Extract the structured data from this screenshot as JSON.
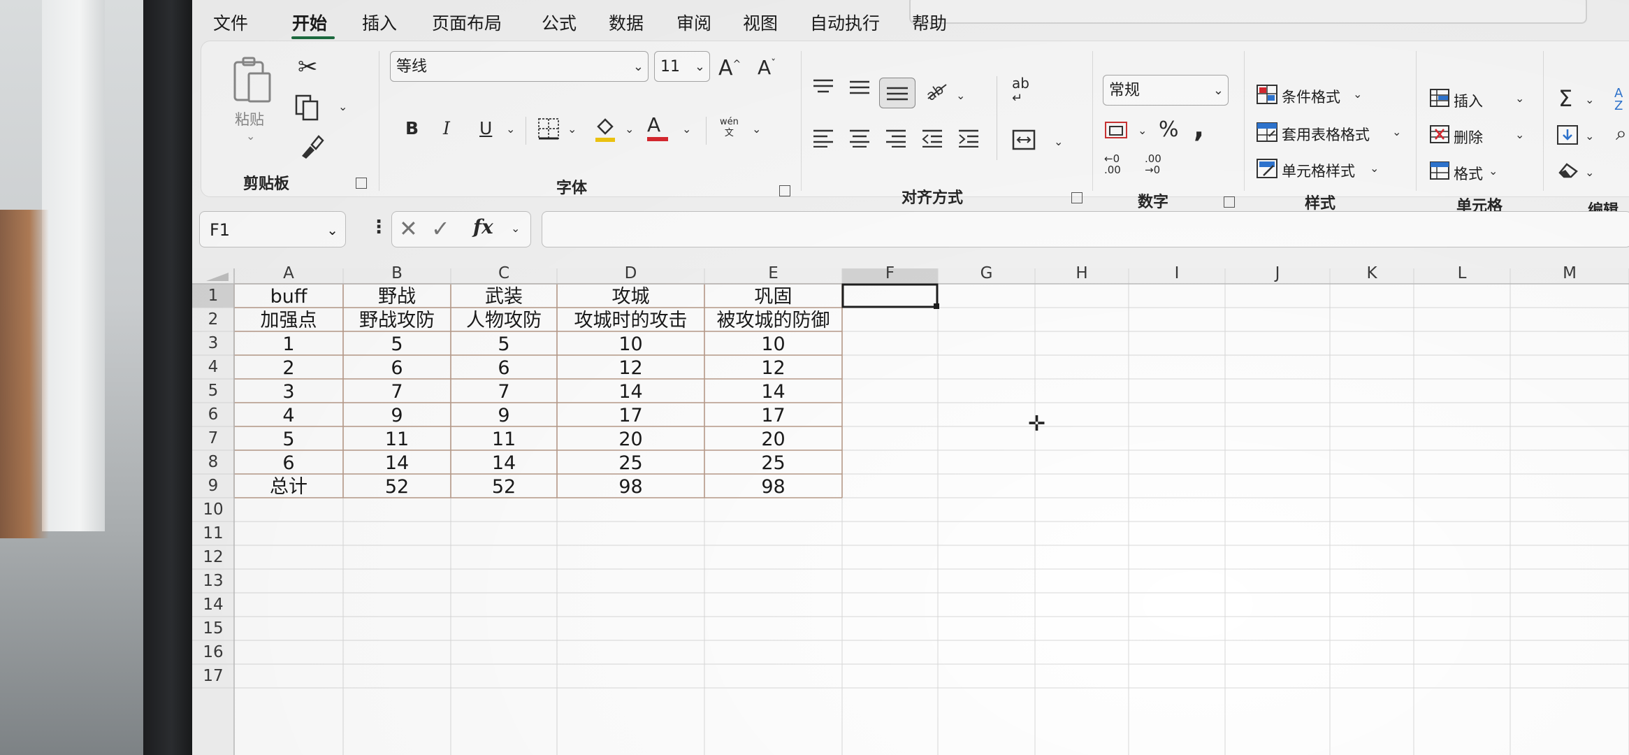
{
  "menu": {
    "tabs": [
      "文件",
      "开始",
      "插入",
      "页面布局",
      "公式",
      "数据",
      "审阅",
      "视图",
      "自动执行",
      "帮助"
    ],
    "active": "开始"
  },
  "ribbon": {
    "clipboard": {
      "paste_label": "粘贴",
      "group_label": "剪贴板"
    },
    "font": {
      "font_name": "等线",
      "font_size": "11",
      "bold": "B",
      "italic": "I",
      "underline": "U",
      "font_color_letter": "A",
      "phonetic_top": "wén",
      "phonetic_bottom": "文",
      "group_label": "字体"
    },
    "alignment": {
      "wrap_label": "ab",
      "group_label": "对齐方式"
    },
    "number": {
      "format": "常规",
      "percent": "%",
      "comma": ",",
      "group_label": "数字",
      "inc_decimal": ".00",
      "dec_decimal": ".00"
    },
    "styles": {
      "conditional_format": "条件格式",
      "table_format": "套用表格格式",
      "cell_styles": "单元格样式",
      "group_label": "样式"
    },
    "cells": {
      "insert": "插入",
      "delete": "删除",
      "format": "格式",
      "group_label": "单元格"
    },
    "editing": {
      "group_label": "编辑"
    }
  },
  "formula_bar": {
    "name_box": "F1",
    "fx": "fx",
    "formula": ""
  },
  "sheet": {
    "columns": [
      "A",
      "B",
      "C",
      "D",
      "E",
      "F",
      "G",
      "H",
      "I",
      "J",
      "K",
      "L",
      "M"
    ],
    "rows": [
      "1",
      "2",
      "3",
      "4",
      "5",
      "6",
      "7",
      "8",
      "9",
      "10",
      "11",
      "12",
      "13",
      "14",
      "15",
      "16",
      "17"
    ],
    "selected_cell": "F1",
    "cells": [
      [
        "buff",
        "野战",
        "武装",
        "攻城",
        "巩固"
      ],
      [
        "加强点",
        "野战攻防",
        "人物攻防",
        "攻城时的攻击",
        "被攻城的防御"
      ],
      [
        "1",
        "5",
        "5",
        "10",
        "10"
      ],
      [
        "2",
        "6",
        "6",
        "12",
        "12"
      ],
      [
        "3",
        "7",
        "7",
        "14",
        "14"
      ],
      [
        "4",
        "9",
        "9",
        "17",
        "17"
      ],
      [
        "5",
        "11",
        "11",
        "20",
        "20"
      ],
      [
        "6",
        "14",
        "14",
        "25",
        "25"
      ],
      [
        "总计",
        "52",
        "52",
        "98",
        "98"
      ]
    ]
  },
  "colors": {
    "accent": "#1d6e41",
    "grid_line": "#d9d9d9",
    "data_border": "#b89b8a"
  }
}
